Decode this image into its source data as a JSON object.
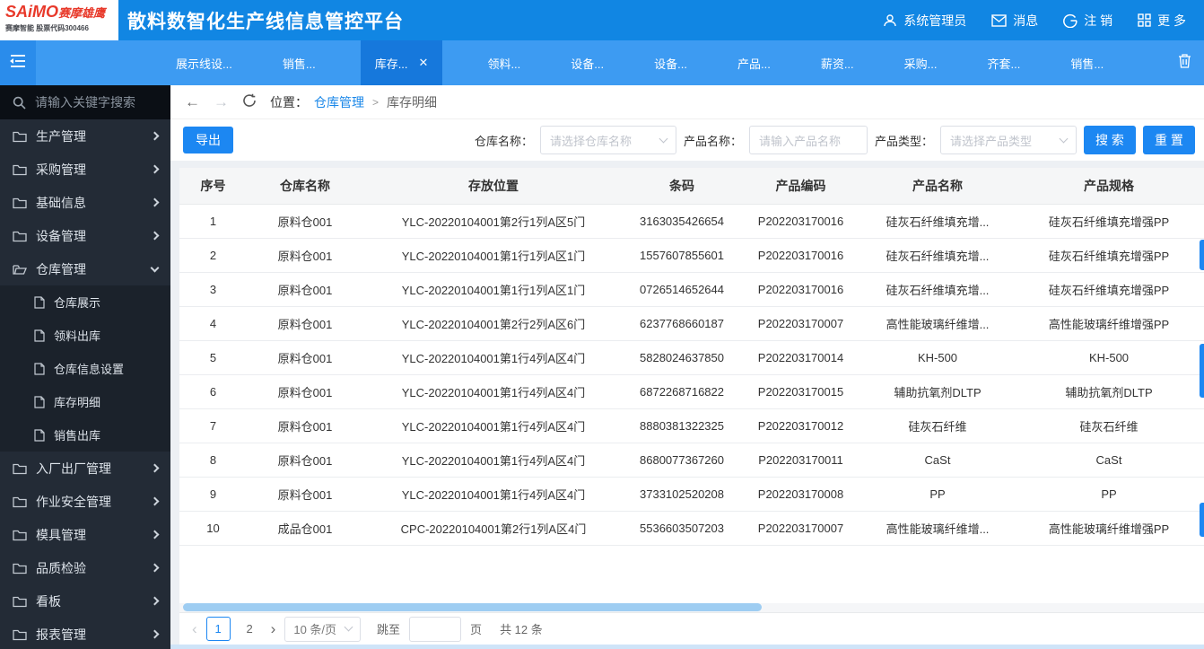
{
  "colors": {
    "header_bg": "#1186e3",
    "tabbar_bg": "#3d9bf2",
    "active_tab_bg": "#1678dc",
    "sidebar_bg": "#232b36",
    "accent_blue": "#1c87f2",
    "link_blue": "#1a87e8",
    "scroll_thumb": "#9ecdf2"
  },
  "header": {
    "logo": {
      "brand": "SAiMO",
      "brand_cn": "赛摩雄鹰",
      "subtitle": "赛摩智能 股票代码300466"
    },
    "title": "散料数智化生产线信息管控平台",
    "actions": {
      "user": "系统管理员",
      "messages": "消息",
      "logout": "注 销",
      "more": "更 多"
    }
  },
  "tabbar": {
    "tabs": [
      {
        "label": "展示线设...",
        "active": false
      },
      {
        "label": "销售...",
        "active": false
      },
      {
        "label": "库存...",
        "active": true,
        "closable": true
      },
      {
        "label": "领料...",
        "active": false
      },
      {
        "label": "设备...",
        "active": false
      },
      {
        "label": "设备...",
        "active": false
      },
      {
        "label": "产品...",
        "active": false
      },
      {
        "label": "薪资...",
        "active": false
      },
      {
        "label": "采购...",
        "active": false
      },
      {
        "label": "齐套...",
        "active": false
      },
      {
        "label": "销售...",
        "active": false
      }
    ],
    "close_glyph": "✕"
  },
  "sidebar": {
    "search_placeholder": "请输入关键字搜索",
    "menu": [
      {
        "label": "生产管理",
        "expanded": false
      },
      {
        "label": "采购管理",
        "expanded": false
      },
      {
        "label": "基础信息",
        "expanded": false
      },
      {
        "label": "设备管理",
        "expanded": false
      },
      {
        "label": "仓库管理",
        "expanded": true,
        "children": [
          "仓库展示",
          "领料出库",
          "仓库信息设置",
          "库存明细",
          "销售出库"
        ]
      },
      {
        "label": "入厂出厂管理",
        "expanded": false
      },
      {
        "label": "作业安全管理",
        "expanded": false
      },
      {
        "label": "模具管理",
        "expanded": false
      },
      {
        "label": "品质检验",
        "expanded": false
      },
      {
        "label": "看板",
        "expanded": false
      },
      {
        "label": "报表管理",
        "expanded": false
      }
    ]
  },
  "breadcrumb": {
    "location_label": "位置：",
    "parent": "仓库管理",
    "separator": ">",
    "current": "库存明细"
  },
  "toolbar": {
    "export_label": "导出",
    "filters": [
      {
        "label": "仓库名称：",
        "placeholder": "请选择仓库名称",
        "type": "select"
      },
      {
        "label": "产品名称：",
        "placeholder": "请输入产品名称",
        "type": "input"
      },
      {
        "label": "产品类型：",
        "placeholder": "请选择产品类型",
        "type": "select"
      }
    ],
    "search_label": "搜 索",
    "reset_label": "重 置"
  },
  "table": {
    "columns": [
      "序号",
      "仓库名称",
      "存放位置",
      "条码",
      "产品编码",
      "产品名称",
      "产品规格"
    ],
    "rows": [
      [
        "1",
        "原料仓001",
        "YLC-20220104001第2行1列A区5门",
        "3163035426654",
        "P202203170016",
        "硅灰石纤维填充增...",
        "硅灰石纤维填充增强PP"
      ],
      [
        "2",
        "原料仓001",
        "YLC-20220104001第1行1列A区1门",
        "1557607855601",
        "P202203170016",
        "硅灰石纤维填充增...",
        "硅灰石纤维填充增强PP"
      ],
      [
        "3",
        "原料仓001",
        "YLC-20220104001第1行1列A区1门",
        "0726514652644",
        "P202203170016",
        "硅灰石纤维填充增...",
        "硅灰石纤维填充增强PP"
      ],
      [
        "4",
        "原料仓001",
        "YLC-20220104001第2行2列A区6门",
        "6237768660187",
        "P202203170007",
        "高性能玻璃纤维增...",
        "高性能玻璃纤维增强PP"
      ],
      [
        "5",
        "原料仓001",
        "YLC-20220104001第1行4列A区4门",
        "5828024637850",
        "P202203170014",
        "KH-500",
        "KH-500"
      ],
      [
        "6",
        "原料仓001",
        "YLC-20220104001第1行4列A区4门",
        "6872268716822",
        "P202203170015",
        "辅助抗氧剂DLTP",
        "辅助抗氧剂DLTP"
      ],
      [
        "7",
        "原料仓001",
        "YLC-20220104001第1行4列A区4门",
        "8880381322325",
        "P202203170012",
        "硅灰石纤维",
        "硅灰石纤维"
      ],
      [
        "8",
        "原料仓001",
        "YLC-20220104001第1行4列A区4门",
        "8680077367260",
        "P202203170011",
        "CaSt",
        "CaSt"
      ],
      [
        "9",
        "原料仓001",
        "YLC-20220104001第1行4列A区4门",
        "3733102520208",
        "P202203170008",
        "PP",
        "PP"
      ],
      [
        "10",
        "成品仓001",
        "CPC-20220104001第2行1列A区4门",
        "5536603507203",
        "P202203170007",
        "高性能玻璃纤维增...",
        "高性能玻璃纤维增强PP"
      ]
    ]
  },
  "pagination": {
    "prev": "‹",
    "next": "›",
    "pages": [
      "1",
      "2"
    ],
    "current": "1",
    "page_size": "10 条/页",
    "jump_label": "跳至",
    "jump_value": "",
    "page_unit": "页",
    "total": "共 12 条"
  }
}
